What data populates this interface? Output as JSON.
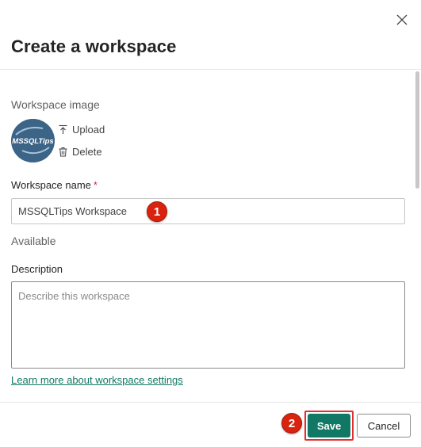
{
  "dialog": {
    "title": "Create a workspace",
    "close_icon": "close-icon"
  },
  "workspace_image": {
    "label": "Workspace image",
    "avatar_text": "MSSQLTips",
    "upload_label": "Upload",
    "delete_label": "Delete"
  },
  "workspace_name": {
    "label": "Workspace name",
    "required_mark": "*",
    "value": "MSSQLTips Workspace",
    "availability": "Available"
  },
  "description": {
    "label": "Description",
    "placeholder": "Describe this workspace",
    "value": ""
  },
  "links": {
    "learn_more": "Learn more about workspace settings"
  },
  "footer": {
    "save_label": "Save",
    "cancel_label": "Cancel"
  },
  "annotations": {
    "marker_1": "1",
    "marker_2": "2"
  },
  "colors": {
    "accent": "#117865",
    "annotation_red": "#d9230f",
    "avatar_bg": "#3c6487"
  }
}
